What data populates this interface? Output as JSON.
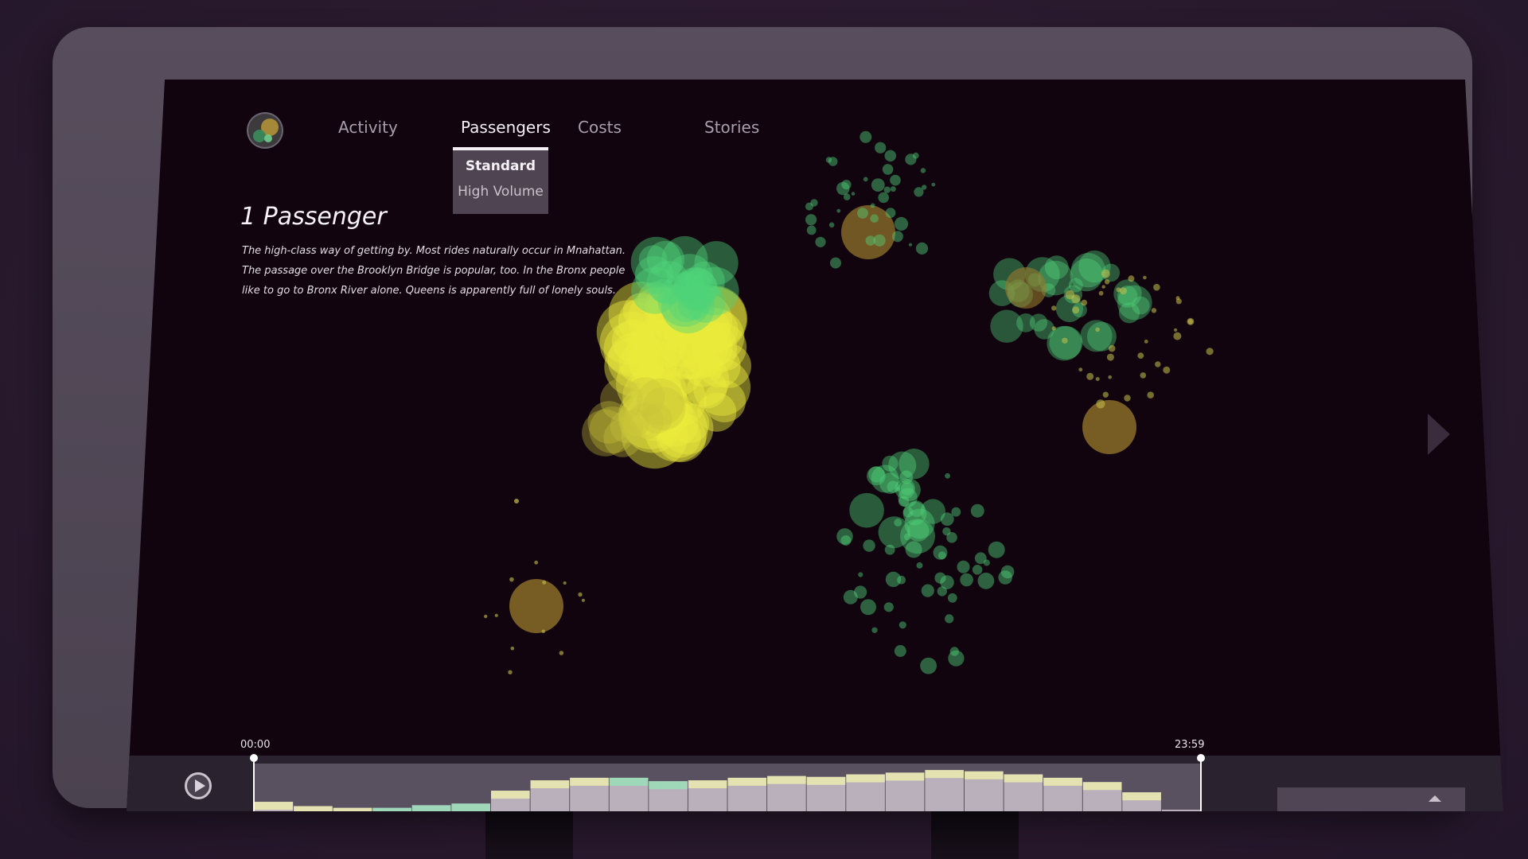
{
  "nav": {
    "tabs": [
      {
        "label": "Activity"
      },
      {
        "label": "Passengers",
        "active": true
      },
      {
        "label": "Costs"
      },
      {
        "label": "Stories"
      }
    ],
    "dropdown": {
      "selected": "Standard",
      "other": "High Volume"
    }
  },
  "panel": {
    "title": "1 Passenger",
    "description": "The high-class way of getting by. Most rides naturally occur in Mnahattan. The passage over the Brooklyn Bridge is popular, too. In the Bronx people like to go to Bronx River alone. Queens is apparently full of lonely souls."
  },
  "timeline": {
    "start_label": "00:00",
    "end_label": "23:59",
    "hourly_activity": [
      0.22,
      0.12,
      0.08,
      0.08,
      0.14,
      0.18,
      0.48,
      0.72,
      0.78,
      0.78,
      0.7,
      0.72,
      0.78,
      0.82,
      0.8,
      0.86,
      0.9,
      0.96,
      0.93,
      0.86,
      0.78,
      0.68,
      0.44,
      0.0
    ]
  },
  "colors": {
    "background": "#11040f",
    "bezel": "#524857",
    "yellow_cluster": "#ecea3c",
    "green_cluster": "#4fd37a",
    "ochre_cluster": "#9a7a2c",
    "histogram_bar": "#b9b0bc",
    "histogram_cap": "#e3e2b0",
    "histogram_cap_green": "#9fd8b8"
  },
  "icons": {
    "logo": "app-logo-icon",
    "play": "play-icon",
    "next": "chevron-right-icon",
    "expand": "caret-up-icon"
  }
}
